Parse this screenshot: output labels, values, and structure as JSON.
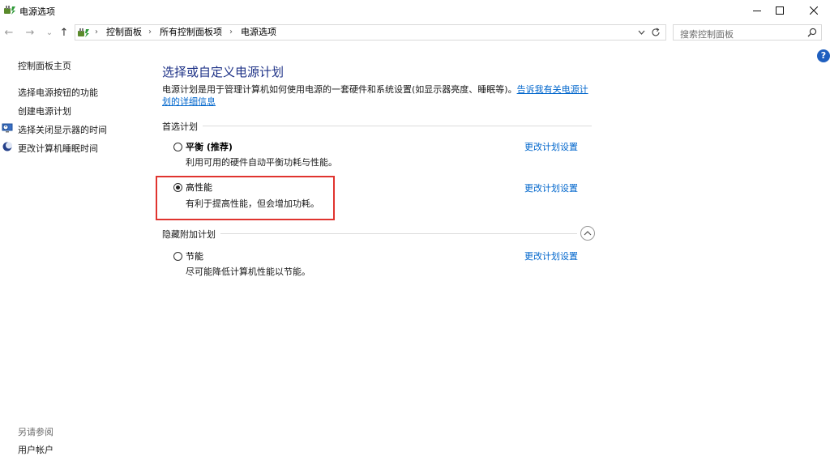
{
  "window": {
    "title": "电源选项",
    "controls": {
      "minimize": "minimize-icon",
      "maximize": "maximize-icon",
      "close": "close-icon"
    }
  },
  "nav": {
    "back": "←",
    "forward": "→",
    "recent": "⌄",
    "up": "↑"
  },
  "breadcrumb": {
    "items": [
      "控制面板",
      "所有控制面板项",
      "电源选项"
    ],
    "separator": "›"
  },
  "search": {
    "placeholder": "搜索控制面板"
  },
  "sidebar": {
    "home": "控制面板主页",
    "links": [
      "选择电源按钮的功能",
      "创建电源计划",
      "选择关闭显示器的时间",
      "更改计算机睡眠时间"
    ],
    "see_also_title": "另请参阅",
    "see_also_links": [
      "用户帐户"
    ]
  },
  "main": {
    "heading": "选择或自定义电源计划",
    "description": "电源计划是用于管理计算机如何使用电源的一套硬件和系统设置(如显示器亮度、睡眠等)。",
    "description_link": "告诉我有关电源计划的详细信息",
    "preferred_section": "首选计划",
    "hidden_section": "隐藏附加计划",
    "change_link": "更改计划设置",
    "plans": [
      {
        "name": "平衡 (推荐)",
        "desc": "利用可用的硬件自动平衡功耗与性能。",
        "selected": false
      },
      {
        "name": "高性能",
        "desc": "有利于提高性能，但会增加功耗。",
        "selected": true
      },
      {
        "name": "节能",
        "desc": "尽可能降低计算机性能以节能。",
        "selected": false
      }
    ]
  },
  "help": {
    "label": "?"
  },
  "colors": {
    "heading": "#1e3287",
    "link": "#0066cc",
    "highlight": "#e0342f"
  }
}
